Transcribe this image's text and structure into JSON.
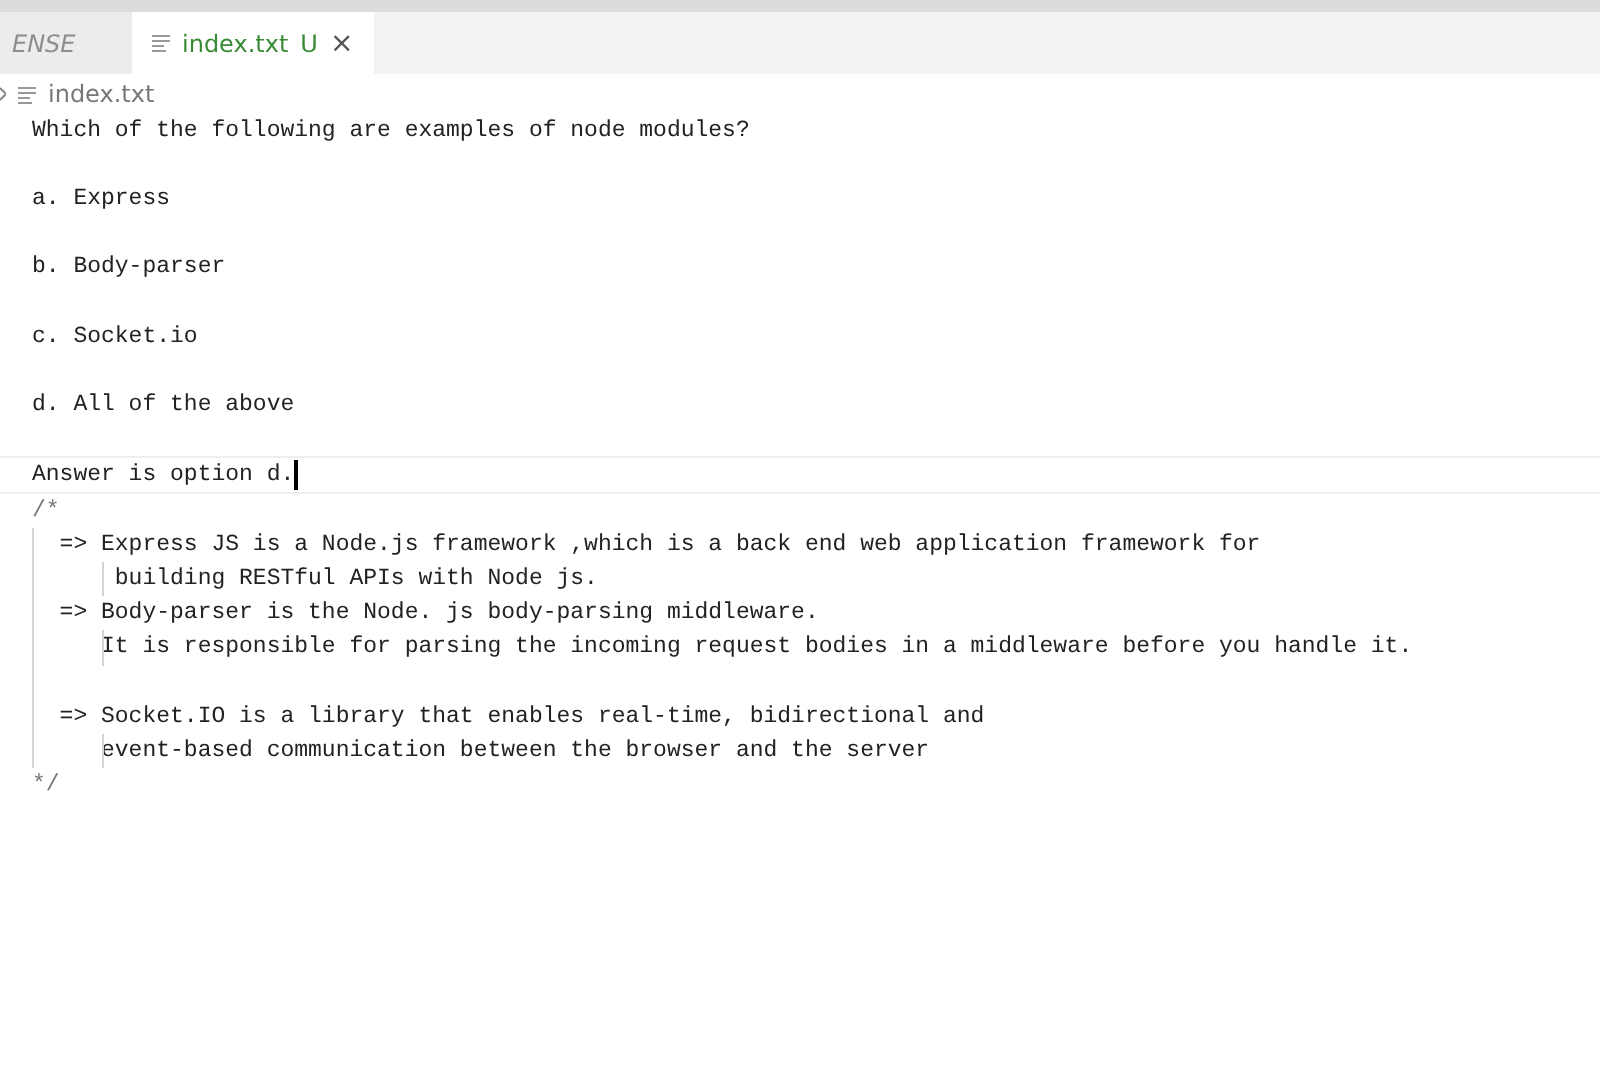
{
  "tabs": [
    {
      "label": "ENSE",
      "selected": false,
      "preview": true
    },
    {
      "label": "index.txt",
      "status": "U",
      "close": "×",
      "selected": true
    }
  ],
  "breadcrumb": {
    "file": "index.txt"
  },
  "lines": [
    {
      "kind": "text",
      "text": "Which of the following are examples of node modules?"
    },
    {
      "kind": "blank"
    },
    {
      "kind": "text",
      "text": "a. Express"
    },
    {
      "kind": "blank"
    },
    {
      "kind": "text",
      "text": "b. Body-parser"
    },
    {
      "kind": "blank"
    },
    {
      "kind": "text",
      "text": "c. Socket.io"
    },
    {
      "kind": "blank"
    },
    {
      "kind": "text",
      "text": "d. All of the above"
    },
    {
      "kind": "blank"
    },
    {
      "kind": "text",
      "text": "Answer is option d.",
      "current": true
    },
    {
      "kind": "text",
      "text": "/*"
    },
    {
      "kind": "text",
      "text": "  => Express JS is a Node.js framework ,which is a back end web application framework for"
    },
    {
      "kind": "text",
      "text": "      building RESTful APIs with Node js."
    },
    {
      "kind": "text",
      "text": "  => Body-parser is the Node. js body-parsing middleware."
    },
    {
      "kind": "text",
      "text": "     It is responsible for parsing the incoming request bodies in a middleware before you handle it."
    },
    {
      "kind": "guide"
    },
    {
      "kind": "text",
      "text": "  => Socket.IO is a library that enables real-time, bidirectional and"
    },
    {
      "kind": "text",
      "text": "     event-based communication between the browser and the server"
    },
    {
      "kind": "text",
      "text": "*/"
    }
  ]
}
